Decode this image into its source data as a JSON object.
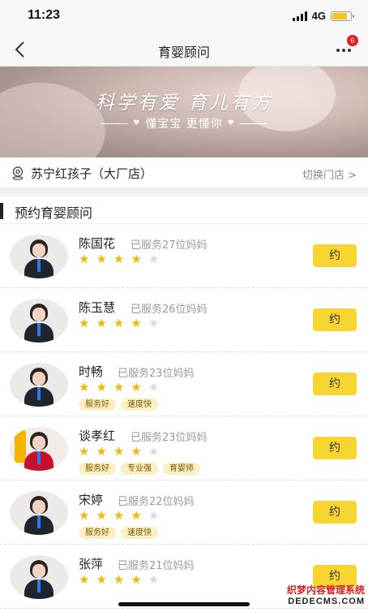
{
  "status": {
    "time": "11:23",
    "network": "4G",
    "battery_level": 0.8,
    "battery_color": "#f5c518"
  },
  "nav": {
    "title": "育婴顾问",
    "badge_count": "6",
    "back_icon": "chevron-left-icon",
    "more_icon": "more-dots-icon"
  },
  "banner": {
    "headline": "科学有爱  育儿有方",
    "subline": "懂宝宝  更懂你"
  },
  "store": {
    "name": "苏宁红孩子（大厂店）",
    "switch_label": "切换门店 >"
  },
  "section": {
    "title": "预约育婴顾问"
  },
  "advisors": [
    {
      "name": "陈国花",
      "served": "已服务27位妈妈",
      "rating": 4,
      "tags": [],
      "book_label": "约"
    },
    {
      "name": "陈玉慧",
      "served": "已服务26位妈妈",
      "rating": 4,
      "tags": [],
      "book_label": "约"
    },
    {
      "name": "时畅",
      "served": "已服务23位妈妈",
      "rating": 4,
      "tags": [
        "服务好",
        "速度快"
      ],
      "book_label": "约"
    },
    {
      "name": "谈孝红",
      "served": "已服务23位妈妈",
      "rating": 4,
      "tags": [
        "服务好",
        "专业强",
        "育婴师"
      ],
      "book_label": "约"
    },
    {
      "name": "宋婷",
      "served": "已服务22位妈妈",
      "rating": 4,
      "tags": [
        "服务好",
        "速度快"
      ],
      "book_label": "约"
    },
    {
      "name": "张萍",
      "served": "已服务21位妈妈",
      "rating": 4,
      "tags": [],
      "book_label": "约"
    }
  ],
  "watermark": {
    "cn": "织梦内容管理系统",
    "en": "DEDECMS.COM"
  },
  "colors": {
    "accent": "#f9d532",
    "star": "#f5b800",
    "tag_bg": "#fcefc2"
  }
}
